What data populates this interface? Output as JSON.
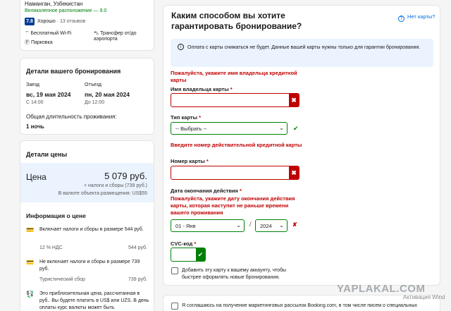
{
  "hotel": {
    "location": "Наманган, Узбекистан",
    "location_note": "Великолепное расположение — 9.0",
    "score": "7.8",
    "score_label": "Хорошо",
    "reviews": "· 13 отзывов",
    "amenities": [
      "Бесплатный Wi-Fi",
      "Трансфер от/до аэропорта",
      "Парковка"
    ]
  },
  "booking": {
    "title": "Детали вашего бронирования",
    "checkin_label": "Заезд",
    "checkin_date": "вс, 19 мая 2024",
    "checkin_time": "С 14:00",
    "checkout_label": "Отъезд",
    "checkout_date": "пн, 20 мая 2024",
    "checkout_time": "До 12:00",
    "duration_label": "Общая длительность проживания:",
    "duration_value": "1 ночь"
  },
  "price": {
    "title": "Детали цены",
    "label": "Цена",
    "amount": "5 079 руб.",
    "taxes": "+ налоги и сборы (739 руб.)",
    "local": "В валюте объекта размещения: US$55"
  },
  "price_info": {
    "title": "Информация о цене",
    "included": "Включает налоги и сборы в размере 544 руб.",
    "vat_label": "12 % НДС",
    "vat_value": "544 руб.",
    "excluded": "Не включает налоги и сборы в размере 739 руб.",
    "tourist_label": "Туристический сбор",
    "tourist_value": "739 руб.",
    "note": "Это приблизительная цена, рассчитанная в руб.. Вы будете платить в US$ или UZS. В день оплаты курс валюты может быть"
  },
  "form": {
    "title": "Каким способом вы хотите гарантировать бронирование?",
    "help": "Нет карты?",
    "info": "Оплата с карты сниматься не будет. Данные вашей карты нужны только для гарантии бронирования.",
    "holder_error": "Пожалуйста, укажите имя владельца кредитной карты",
    "holder_label": "Имя владельца карты",
    "type_label": "Тип карты",
    "type_value": "-- Выбрать --",
    "number_error": "Введите номер действительной кредитной карты",
    "number_label": "Номер карты",
    "expiry_label": "Дата окончания действия",
    "expiry_error": "Пожалуйста, укажите дату окончания действия карты, которая наступит не раньше времени вашего проживания",
    "month_value": "01 - Янв",
    "year_value": "2024",
    "cvc_label": "CVC-код",
    "save_card": "Добавить эту карту к вашему аккаунту, чтобы быстрее оформлять новые бронирования.",
    "marketing": "Я соглашаюсь на получение маркетинговых рассылок Booking.com, в том числе писем о специальных"
  },
  "overlay": {
    "watermark": "YAPLAKAL.COM",
    "activation": "Активация Wind"
  }
}
